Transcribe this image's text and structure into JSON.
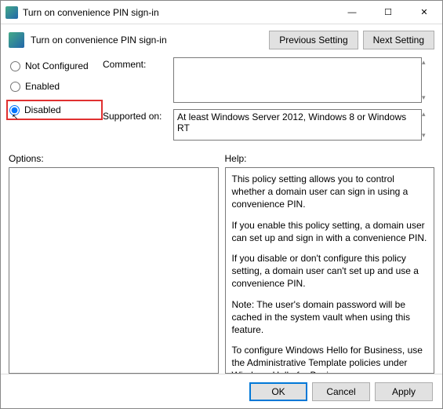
{
  "titlebar": {
    "title": "Turn on convenience PIN sign-in"
  },
  "header": {
    "title": "Turn on convenience PIN sign-in",
    "previous_btn": "Previous Setting",
    "next_btn": "Next Setting"
  },
  "radio": {
    "not_configured": "Not Configured",
    "enabled": "Enabled",
    "disabled": "Disabled",
    "selected": "disabled"
  },
  "fields": {
    "comment_label": "Comment:",
    "comment_value": "",
    "supported_label": "Supported on:",
    "supported_value": "At least Windows Server 2012, Windows 8 or Windows RT"
  },
  "panes": {
    "options_label": "Options:",
    "help_label": "Help:"
  },
  "help": {
    "p1": "This policy setting allows you to control whether a domain user can sign in using a convenience PIN.",
    "p2": "If you enable this policy setting, a domain user can set up and sign in with a convenience PIN.",
    "p3": "If you disable or don't configure this policy setting, a domain user can't set up and use a convenience PIN.",
    "p4": "Note: The user's domain password will be cached in the system vault when using this feature.",
    "p5": "To configure Windows Hello for Business, use the Administrative Template policies under Windows Hello for Business."
  },
  "footer": {
    "ok": "OK",
    "cancel": "Cancel",
    "apply": "Apply"
  }
}
